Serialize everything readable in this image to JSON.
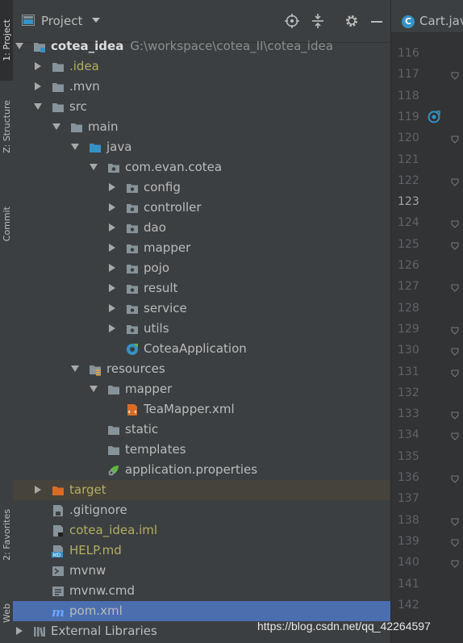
{
  "side_tabs": {
    "project": "1: Project",
    "structure": "Z: Structure",
    "commit": "Commit",
    "favorites": "2: Favorites",
    "web": "Web"
  },
  "panel": {
    "title": "Project",
    "icons": [
      "locate-icon",
      "collapse-all-icon",
      "gear-icon",
      "minimize-icon"
    ]
  },
  "tree": [
    {
      "label": "cotea_idea",
      "path": "G:\\workspace\\cotea_II\\cotea_idea",
      "icon": "module-folder",
      "expanded": true,
      "bold": true
    },
    {
      "label": ".idea",
      "icon": "folder",
      "expanded": false,
      "color": "olive"
    },
    {
      "label": ".mvn",
      "icon": "folder",
      "expanded": false
    },
    {
      "label": "src",
      "icon": "folder",
      "expanded": true
    },
    {
      "label": "main",
      "icon": "folder",
      "expanded": true
    },
    {
      "label": "java",
      "icon": "source-folder",
      "expanded": true
    },
    {
      "label": "com.evan.cotea",
      "icon": "package",
      "expanded": true
    },
    {
      "label": "config",
      "icon": "package",
      "expanded": false
    },
    {
      "label": "controller",
      "icon": "package",
      "expanded": false
    },
    {
      "label": "dao",
      "icon": "package",
      "expanded": false
    },
    {
      "label": "mapper",
      "icon": "package",
      "expanded": false
    },
    {
      "label": "pojo",
      "icon": "package",
      "expanded": false
    },
    {
      "label": "result",
      "icon": "package",
      "expanded": false
    },
    {
      "label": "service",
      "icon": "package",
      "expanded": false
    },
    {
      "label": "utils",
      "icon": "package",
      "expanded": false
    },
    {
      "label": "CoteaApplication",
      "icon": "spring-class"
    },
    {
      "label": "resources",
      "icon": "resources-folder",
      "expanded": true
    },
    {
      "label": "mapper",
      "icon": "folder",
      "expanded": true
    },
    {
      "label": "TeaMapper.xml",
      "icon": "xml-file"
    },
    {
      "label": "static",
      "icon": "folder"
    },
    {
      "label": "templates",
      "icon": "folder"
    },
    {
      "label": "application.properties",
      "icon": "properties-file"
    },
    {
      "label": "target",
      "icon": "excluded-folder",
      "expanded": false,
      "color": "olive"
    },
    {
      "label": ".gitignore",
      "icon": "gitignore-file"
    },
    {
      "label": "cotea_idea.iml",
      "icon": "iml-file",
      "color": "olive"
    },
    {
      "label": "HELP.md",
      "icon": "md-file",
      "color": "olive"
    },
    {
      "label": "mvnw",
      "icon": "shell-file"
    },
    {
      "label": "mvnw.cmd",
      "icon": "text-file"
    },
    {
      "label": "pom.xml",
      "icon": "maven-file",
      "selected": true
    },
    {
      "label": "External Libraries",
      "icon": "libraries",
      "expanded": false
    }
  ],
  "editor": {
    "tab_label": "Cart.java",
    "line_numbers": [
      "116",
      "117",
      "118",
      "119",
      "120",
      "121",
      "122",
      "123",
      "124",
      "125",
      "126",
      "127",
      "128",
      "129",
      "130",
      "131",
      "132",
      "133",
      "134",
      "135",
      "136",
      "137",
      "138",
      "139",
      "140",
      "141",
      "142"
    ],
    "current_line": "123"
  },
  "watermark": "https://blog.csdn.net/qq_42264597"
}
